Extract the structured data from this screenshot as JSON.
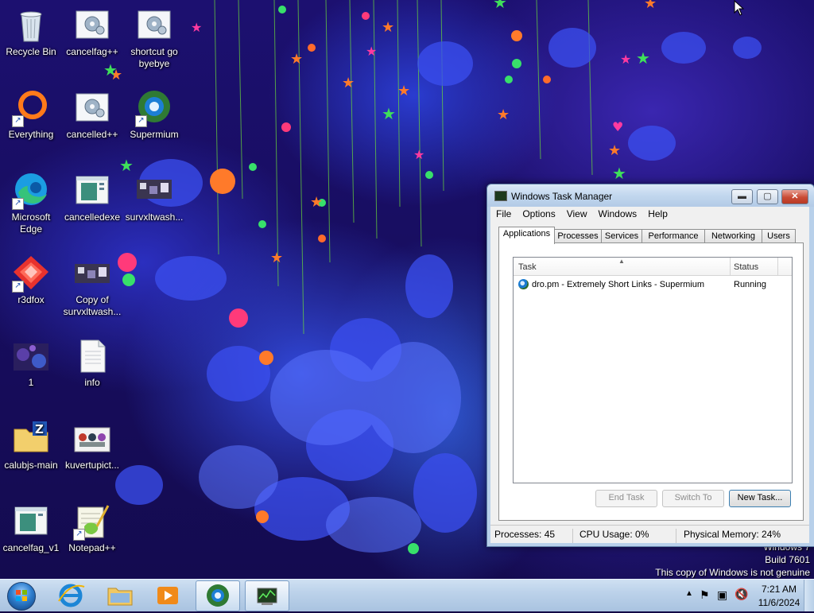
{
  "desktop": {
    "icons": [
      {
        "label": "Recycle Bin"
      },
      {
        "label": "cancelfag++"
      },
      {
        "label": "shortcut go byebye"
      },
      {
        "label": "Everything"
      },
      {
        "label": "cancelled++"
      },
      {
        "label": "Supermium"
      },
      {
        "label": "Microsoft Edge"
      },
      {
        "label": "cancelledexe"
      },
      {
        "label": "survxltwash..."
      },
      {
        "label": "r3dfox"
      },
      {
        "label": "Copy of survxltwash..."
      },
      {
        "label": "1"
      },
      {
        "label": "info"
      },
      {
        "label": "calubjs-main"
      },
      {
        "label": "kuvertupict..."
      },
      {
        "label": "cancelfag_v1"
      },
      {
        "label": "Notepad++"
      }
    ]
  },
  "watermark": {
    "line1": "Windows 7",
    "line2": "Build 7601",
    "line3": "This copy of Windows is not genuine"
  },
  "taskmgr": {
    "title": "Windows Task Manager",
    "window_buttons": {
      "minimize": "▬",
      "maximize": "▢",
      "close": "✕"
    },
    "menu": [
      "File",
      "Options",
      "View",
      "Windows",
      "Help"
    ],
    "tabs": [
      "Applications",
      "Processes",
      "Services",
      "Performance",
      "Networking",
      "Users"
    ],
    "active_tab": "Applications",
    "columns": {
      "task": "Task",
      "status": "Status"
    },
    "rows": [
      {
        "task": "dro.pm - Extremely Short Links - Supermium",
        "status": "Running"
      }
    ],
    "buttons": {
      "end_task": "End Task",
      "switch_to": "Switch To",
      "new_task": "New Task..."
    },
    "statusbar": {
      "processes": "Processes: 45",
      "cpu": "CPU Usage: 0%",
      "memory": "Physical Memory: 24%"
    }
  },
  "taskbar": {
    "pinned": [
      "start-orb",
      "internet-explorer",
      "windows-explorer",
      "media-player",
      "supermium",
      "task-manager"
    ],
    "clock": {
      "time": "7:21 AM",
      "date": "11/6/2024"
    }
  },
  "colors": {
    "taskbar": "#bcd2ea",
    "window_frame": "#b8d0ea",
    "close_button": "#c94a34"
  }
}
